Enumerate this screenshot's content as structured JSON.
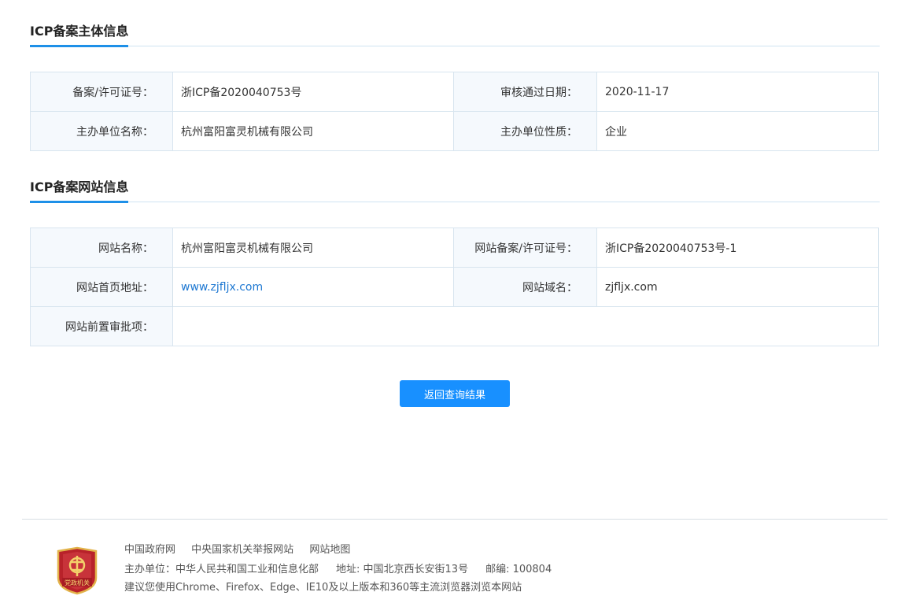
{
  "sections": {
    "subject": {
      "title": "ICP备案主体信息",
      "rows": [
        {
          "label1": "备案/许可证号：",
          "value1": "浙ICP备2020040753号",
          "label2": "审核通过日期：",
          "value2": "2020-11-17"
        },
        {
          "label1": "主办单位名称：",
          "value1": "杭州富阳富灵机械有限公司",
          "label2": "主办单位性质：",
          "value2": "企业"
        }
      ]
    },
    "website": {
      "title": "ICP备案网站信息",
      "name_label": "网站名称：",
      "name_value": "杭州富阳富灵机械有限公司",
      "license_label": "网站备案/许可证号：",
      "license_value": "浙ICP备2020040753号-1",
      "homepage_label": "网站首页地址：",
      "homepage_value": "www.zjfljx.com",
      "domain_label": "网站域名：",
      "domain_value": "zjfljx.com",
      "preapproval_label": "网站前置审批项：",
      "preapproval_value": ""
    }
  },
  "back_button": "返回查询结果",
  "footer": {
    "links": [
      "中国政府网",
      "中央国家机关举报网站",
      "网站地图"
    ],
    "sponsor": "主办单位：中华人民共和国工业和信息化部",
    "address": "地址: 中国北京西长安街13号",
    "postcode": "邮编: 100804",
    "browser_note": "建议您使用Chrome、Firefox、Edge、IE10及以上版本和360等主流浏览器浏览本网站",
    "emblem_text": "党政机关"
  },
  "colors": {
    "accent": "#1890ff",
    "link": "#1e78d2",
    "label_bg": "#f5f9fd",
    "border": "#d8e5ef"
  }
}
